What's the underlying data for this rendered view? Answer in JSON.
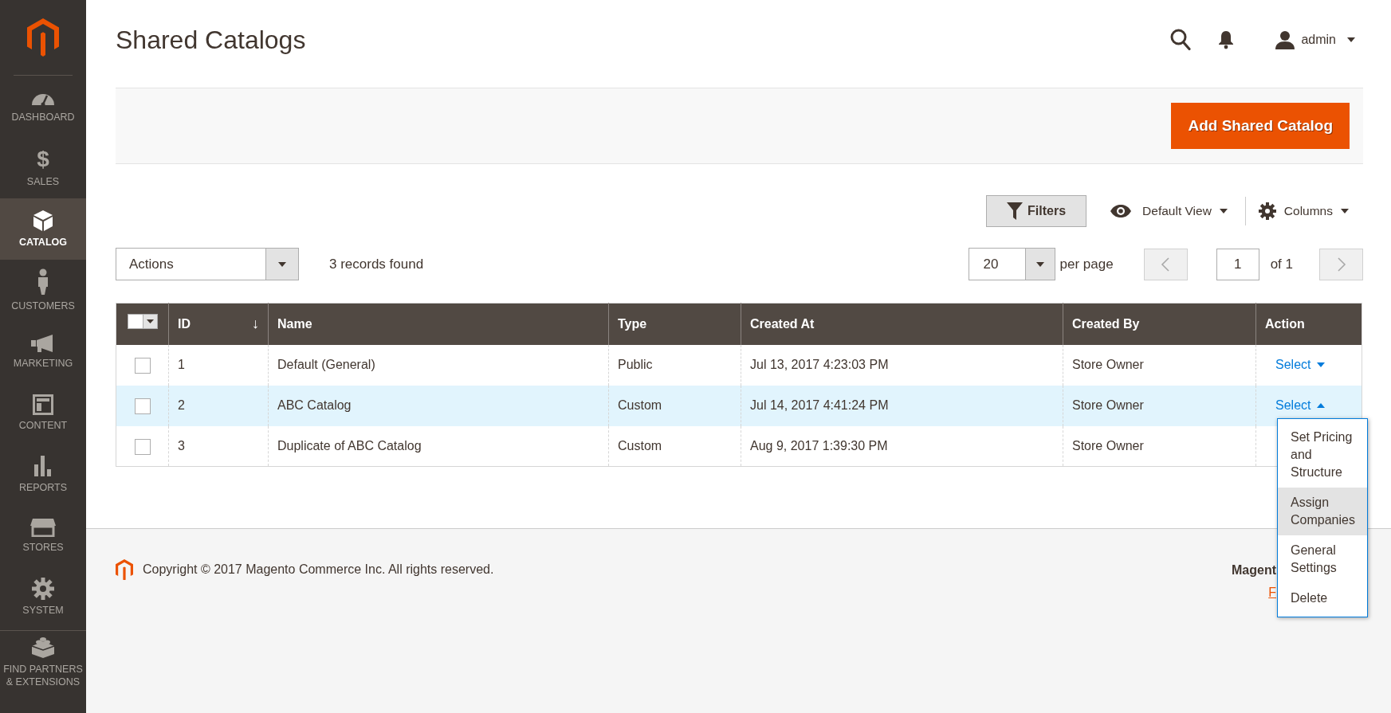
{
  "sidebar": {
    "items": [
      {
        "kind": "dashboard",
        "label": "DASHBOARD",
        "selected": false
      },
      {
        "kind": "sales",
        "glyph": "$",
        "label": "SALES",
        "selected": false
      },
      {
        "kind": "catalog",
        "label": "CATALOG",
        "selected": true
      },
      {
        "kind": "customers",
        "label": "CUSTOMERS",
        "selected": false
      },
      {
        "kind": "marketing",
        "label": "MARKETING",
        "selected": false
      },
      {
        "kind": "content",
        "label": "CONTENT",
        "selected": false
      },
      {
        "kind": "reports",
        "label": "REPORTS",
        "selected": false
      },
      {
        "kind": "stores",
        "label": "STORES",
        "selected": false
      },
      {
        "kind": "system",
        "label": "SYSTEM",
        "selected": false
      },
      {
        "kind": "partners",
        "label": "FIND PARTNERS & EXTENSIONS",
        "selected": false
      }
    ]
  },
  "page_title": "Shared Catalogs",
  "user": {
    "name": "admin"
  },
  "add_button": "Add Shared Catalog",
  "toolbar": {
    "filters": "Filters",
    "view": "Default View",
    "columns": "Columns"
  },
  "actions_select": "Actions",
  "records": "3 records found",
  "pager": {
    "per_page_value": "20",
    "per_page_label": "per page",
    "page": "1",
    "of": "of 1",
    "prev_disabled": true,
    "next_disabled": true
  },
  "table": {
    "columns": [
      {
        "label": "ID",
        "sort_mark": "↓"
      },
      {
        "label": "Name"
      },
      {
        "label": "Type"
      },
      {
        "label": "Created At"
      },
      {
        "label": "Created By"
      },
      {
        "label": "Action"
      }
    ],
    "rows": [
      {
        "checked": false,
        "highlighted": false,
        "cells": [
          "1",
          "Default (General)",
          "Public",
          "Jul 13, 2017 4:23:03 PM",
          "Store Owner"
        ],
        "action": "Select",
        "expanded": false
      },
      {
        "checked": false,
        "highlighted": true,
        "cells": [
          "2",
          "ABC Catalog",
          "Custom",
          "Jul 14, 2017 4:41:24 PM",
          "Store Owner"
        ],
        "action": "Select",
        "expanded": true,
        "menu": [
          {
            "label": "Set Pricing and Structure",
            "highlighted": false
          },
          {
            "label": "Assign Companies",
            "highlighted": true
          },
          {
            "label": "General Settings",
            "highlighted": false
          },
          {
            "label": "Delete",
            "highlighted": false
          }
        ]
      },
      {
        "checked": false,
        "highlighted": false,
        "cells": [
          "3",
          "Duplicate of ABC Catalog",
          "Custom",
          "Aug 9, 2017 1:39:30 PM",
          "Store Owner"
        ]
      }
    ]
  },
  "footer": {
    "copyright": "Copyright © 2017 Magento Commerce Inc. All rights reserved.",
    "brand": "Magent",
    "link": "F"
  }
}
